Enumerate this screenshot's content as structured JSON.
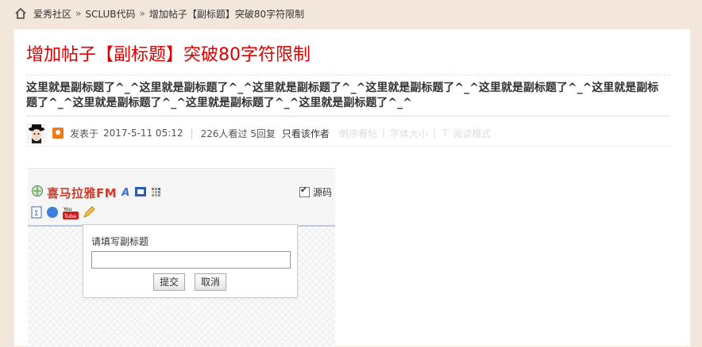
{
  "breadcrumb": {
    "items": [
      "爱秀社区",
      "SCLUB代码",
      "增加帖子【副标题】突破80字符限制"
    ],
    "separator": "»"
  },
  "post": {
    "title": "增加帖子【副标题】突破80字符限制",
    "subtitle": "这里就是副标题了^_^这里就是副标题了^_^这里就是副标题了^_^这里就是副标题了^_^这里就是副标题了^_^这里就是副标题了^_^这里就是副标题了^_^这里就是副标题了^_^这里就是副标题了^_^",
    "posted_label": "发表于",
    "posted_time": "2017-5-11 05:12",
    "stats": "226人看过 5回复",
    "author_only": "只看该作者",
    "reverse_browse": "倒序看帖",
    "font_size": "字体大小",
    "read_mode": "阅读模式"
  },
  "screenshot": {
    "logo_text": "喜马拉雅FM",
    "source_label": "源码",
    "source_checked": true,
    "prompt_label": "请填写副标题",
    "input_value": "",
    "submit": "提交",
    "cancel": "取消"
  },
  "colors": {
    "background": "#f3e7dc",
    "title": "#e00000",
    "badge": "#f07a1a"
  }
}
